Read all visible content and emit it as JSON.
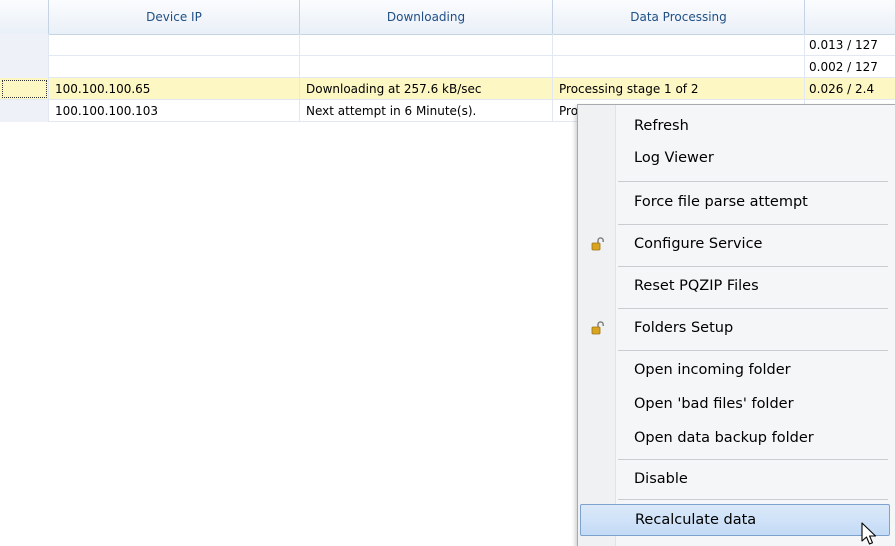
{
  "grid": {
    "headers": {
      "device_ip": "Device IP",
      "downloading": "Downloading",
      "data_processing": "Data Processing"
    },
    "rows": [
      {
        "ip": "",
        "downloading": "",
        "processing": "",
        "extra": "0.013 / 127"
      },
      {
        "ip": "",
        "downloading": "",
        "processing": "",
        "extra": "0.002 / 127"
      },
      {
        "ip": "100.100.100.65",
        "downloading": "Downloading at 257.6 kB/sec",
        "processing": "Processing stage 1 of 2",
        "extra": "0.026 / 2.4"
      },
      {
        "ip": "100.100.100.103",
        "downloading": "Next attempt in 6 Minute(s).",
        "processing": "Pro",
        "extra": ""
      }
    ]
  },
  "context_menu": {
    "items": {
      "refresh": "Refresh",
      "log_viewer": "Log Viewer",
      "force_parse": "Force file parse attempt",
      "configure_service": "Configure Service",
      "reset_pqzip": "Reset PQZIP Files",
      "folders_setup": "Folders Setup",
      "open_incoming": "Open incoming folder",
      "open_bad_files": "Open 'bad files' folder",
      "open_backup": "Open data backup folder",
      "disable": "Disable",
      "recalculate": "Recalculate data"
    },
    "icons": {
      "lock": "unlocked-padlock-icon",
      "cursor": "mouse-pointer-icon"
    },
    "colors": {
      "hover_fill": "#c4dbf6",
      "hover_border": "#7da2ce",
      "selected_row": "#fdf7c4",
      "header_text": "#1f4f87"
    }
  }
}
